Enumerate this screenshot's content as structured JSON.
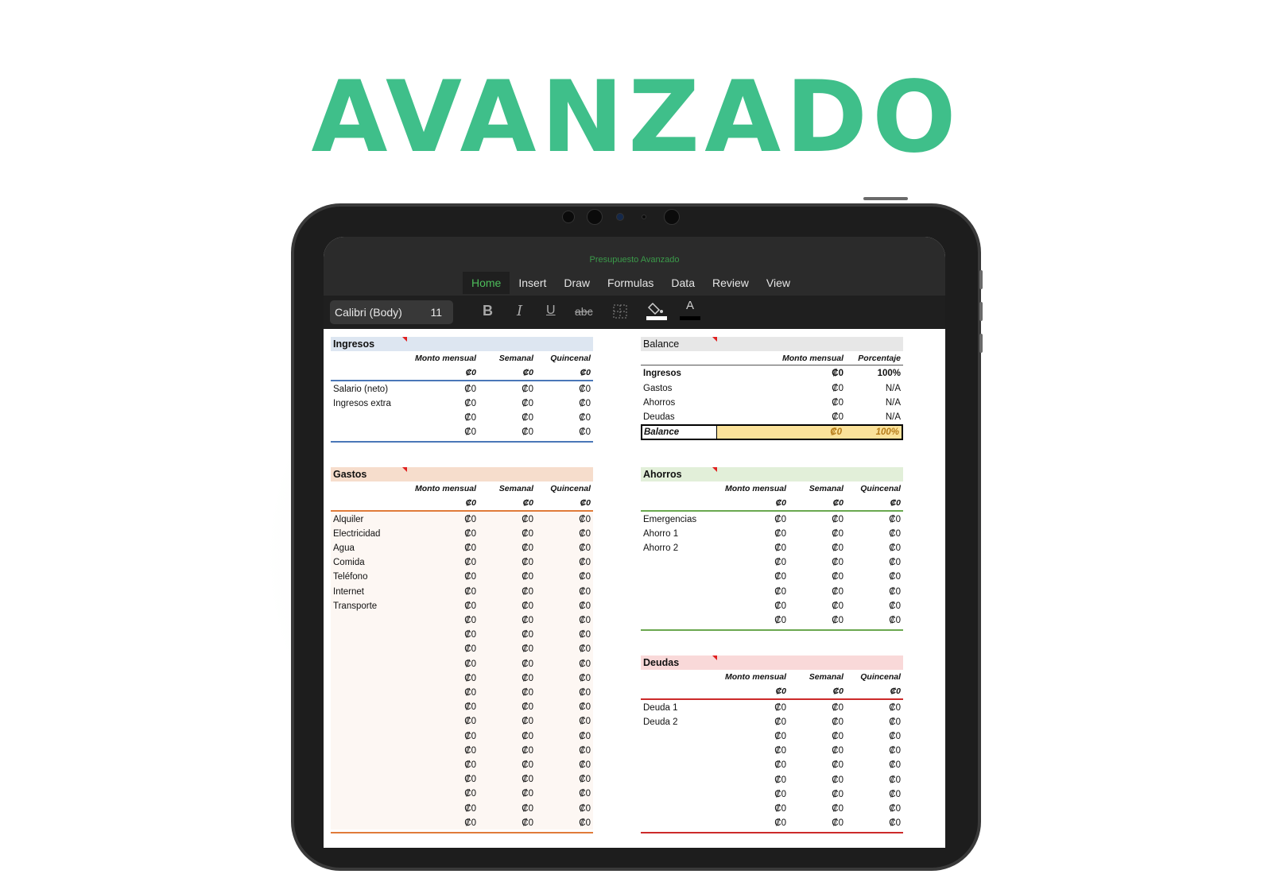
{
  "headline": "AVANZADO",
  "app": {
    "doc_title": "Presupuesto Avanzado",
    "tabs": [
      "Home",
      "Insert",
      "Draw",
      "Formulas",
      "Data",
      "Review",
      "View"
    ],
    "active_tab": "Home",
    "font_name": "Calibri (Body)",
    "font_size": "11",
    "tools": {
      "bold": "B",
      "italic": "I",
      "underline": "U",
      "strike": "abc",
      "font_color": "A"
    }
  },
  "colors": {
    "headline": "#3fbf8a",
    "ingresos_header": "#dde6f1",
    "ingresos_line": "#4a77b8",
    "gastos_header": "#f6ddcc",
    "gastos_line": "#e07b3a",
    "gastos_fill": "#fdf7f3",
    "ahorros_header": "#e2efd9",
    "ahorros_line": "#6aa84f",
    "deudas_header": "#f9d9d9",
    "deudas_line": "#cc2a2a",
    "balance_header": "#e7e7e7",
    "balance_highlight": "#fbe29a",
    "balance_text": "#b57b18"
  },
  "ingresos": {
    "title": "Ingresos",
    "cols": [
      "Monto mensual",
      "Semanal",
      "Quincenal"
    ],
    "totals": [
      "₡0",
      "₡0",
      "₡0"
    ],
    "rows": [
      {
        "label": "Salario (neto)",
        "v": [
          "₡0",
          "₡0",
          "₡0"
        ]
      },
      {
        "label": "Ingresos extra",
        "v": [
          "₡0",
          "₡0",
          "₡0"
        ]
      },
      {
        "label": "",
        "v": [
          "₡0",
          "₡0",
          "₡0"
        ]
      },
      {
        "label": "",
        "v": [
          "₡0",
          "₡0",
          "₡0"
        ]
      }
    ]
  },
  "gastos": {
    "title": "Gastos",
    "cols": [
      "Monto mensual",
      "Semanal",
      "Quincenal"
    ],
    "totals": [
      "₡0",
      "₡0",
      "₡0"
    ],
    "rows": [
      {
        "label": "Alquiler",
        "v": [
          "₡0",
          "₡0",
          "₡0"
        ]
      },
      {
        "label": "Electricidad",
        "v": [
          "₡0",
          "₡0",
          "₡0"
        ]
      },
      {
        "label": "Agua",
        "v": [
          "₡0",
          "₡0",
          "₡0"
        ]
      },
      {
        "label": "Comida",
        "v": [
          "₡0",
          "₡0",
          "₡0"
        ]
      },
      {
        "label": "Teléfono",
        "v": [
          "₡0",
          "₡0",
          "₡0"
        ]
      },
      {
        "label": "Internet",
        "v": [
          "₡0",
          "₡0",
          "₡0"
        ]
      },
      {
        "label": "Transporte",
        "v": [
          "₡0",
          "₡0",
          "₡0"
        ]
      },
      {
        "label": "",
        "v": [
          "₡0",
          "₡0",
          "₡0"
        ]
      },
      {
        "label": "",
        "v": [
          "₡0",
          "₡0",
          "₡0"
        ]
      },
      {
        "label": "",
        "v": [
          "₡0",
          "₡0",
          "₡0"
        ]
      },
      {
        "label": "",
        "v": [
          "₡0",
          "₡0",
          "₡0"
        ]
      },
      {
        "label": "",
        "v": [
          "₡0",
          "₡0",
          "₡0"
        ]
      },
      {
        "label": "",
        "v": [
          "₡0",
          "₡0",
          "₡0"
        ]
      },
      {
        "label": "",
        "v": [
          "₡0",
          "₡0",
          "₡0"
        ]
      },
      {
        "label": "",
        "v": [
          "₡0",
          "₡0",
          "₡0"
        ]
      },
      {
        "label": "",
        "v": [
          "₡0",
          "₡0",
          "₡0"
        ]
      },
      {
        "label": "",
        "v": [
          "₡0",
          "₡0",
          "₡0"
        ]
      },
      {
        "label": "",
        "v": [
          "₡0",
          "₡0",
          "₡0"
        ]
      },
      {
        "label": "",
        "v": [
          "₡0",
          "₡0",
          "₡0"
        ]
      },
      {
        "label": "",
        "v": [
          "₡0",
          "₡0",
          "₡0"
        ]
      },
      {
        "label": "",
        "v": [
          "₡0",
          "₡0",
          "₡0"
        ]
      },
      {
        "label": "",
        "v": [
          "₡0",
          "₡0",
          "₡0"
        ]
      }
    ]
  },
  "balance": {
    "title": "Balance",
    "cols": [
      "Monto mensual",
      "Porcentaje"
    ],
    "rows": [
      {
        "label": "Ingresos",
        "v": [
          "₡0",
          "100%"
        ],
        "bold": true
      },
      {
        "label": "Gastos",
        "v": [
          "₡0",
          "N/A"
        ]
      },
      {
        "label": "Ahorros",
        "v": [
          "₡0",
          "N/A"
        ]
      },
      {
        "label": "Deudas",
        "v": [
          "₡0",
          "N/A"
        ]
      }
    ],
    "total": {
      "label": "Balance",
      "v": [
        "₡0",
        "100%"
      ]
    }
  },
  "ahorros": {
    "title": "Ahorros",
    "cols": [
      "Monto mensual",
      "Semanal",
      "Quincenal"
    ],
    "totals": [
      "₡0",
      "₡0",
      "₡0"
    ],
    "rows": [
      {
        "label": "Emergencias",
        "v": [
          "₡0",
          "₡0",
          "₡0"
        ]
      },
      {
        "label": "Ahorro 1",
        "v": [
          "₡0",
          "₡0",
          "₡0"
        ]
      },
      {
        "label": "Ahorro 2",
        "v": [
          "₡0",
          "₡0",
          "₡0"
        ]
      },
      {
        "label": "",
        "v": [
          "₡0",
          "₡0",
          "₡0"
        ]
      },
      {
        "label": "",
        "v": [
          "₡0",
          "₡0",
          "₡0"
        ]
      },
      {
        "label": "",
        "v": [
          "₡0",
          "₡0",
          "₡0"
        ]
      },
      {
        "label": "",
        "v": [
          "₡0",
          "₡0",
          "₡0"
        ]
      },
      {
        "label": "",
        "v": [
          "₡0",
          "₡0",
          "₡0"
        ]
      }
    ]
  },
  "deudas": {
    "title": "Deudas",
    "cols": [
      "Monto mensual",
      "Semanal",
      "Quincenal"
    ],
    "totals": [
      "₡0",
      "₡0",
      "₡0"
    ],
    "rows": [
      {
        "label": "Deuda 1",
        "v": [
          "₡0",
          "₡0",
          "₡0"
        ]
      },
      {
        "label": "Deuda 2",
        "v": [
          "₡0",
          "₡0",
          "₡0"
        ]
      },
      {
        "label": "",
        "v": [
          "₡0",
          "₡0",
          "₡0"
        ]
      },
      {
        "label": "",
        "v": [
          "₡0",
          "₡0",
          "₡0"
        ]
      },
      {
        "label": "",
        "v": [
          "₡0",
          "₡0",
          "₡0"
        ]
      },
      {
        "label": "",
        "v": [
          "₡0",
          "₡0",
          "₡0"
        ]
      },
      {
        "label": "",
        "v": [
          "₡0",
          "₡0",
          "₡0"
        ]
      },
      {
        "label": "",
        "v": [
          "₡0",
          "₡0",
          "₡0"
        ]
      },
      {
        "label": "",
        "v": [
          "₡0",
          "₡0",
          "₡0"
        ]
      }
    ]
  }
}
